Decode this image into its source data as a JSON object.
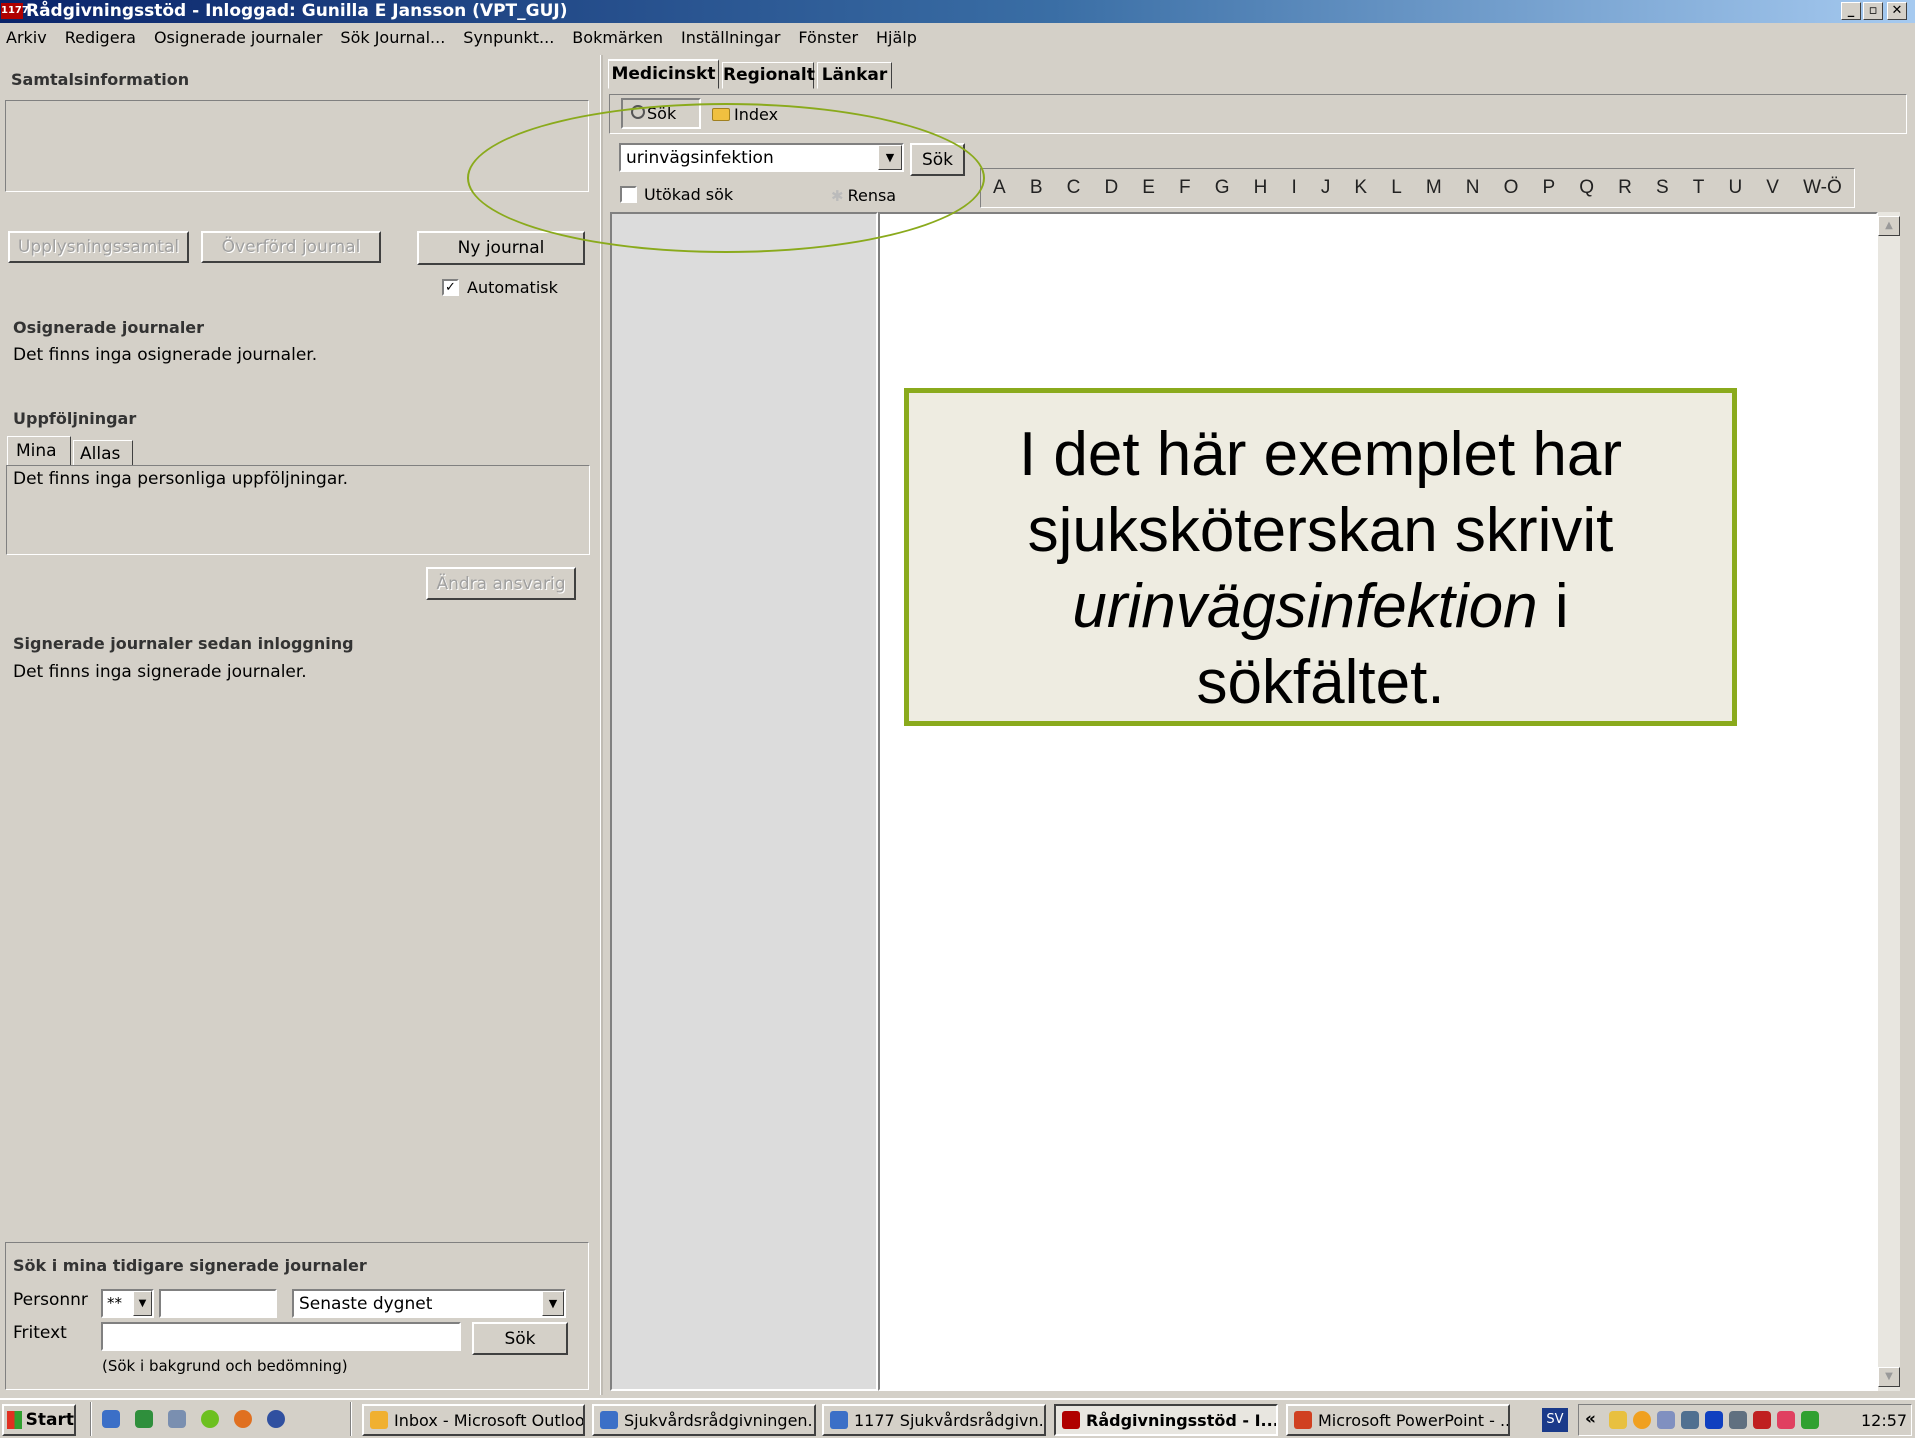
{
  "window": {
    "title": "Rådgivningsstöd - Inloggad: Gunilla E Jansson (VPT_GUJ)",
    "app_badge": "1177",
    "controls": [
      "_",
      "▫",
      "✕"
    ]
  },
  "menu": [
    "Arkiv",
    "Redigera",
    "Osignerade journaler",
    "Sök Journal...",
    "Synpunkt...",
    "Bokmärken",
    "Inställningar",
    "Fönster",
    "Hjälp"
  ],
  "left": {
    "samtal_heading": "Samtalsinformation",
    "buttons": {
      "upplysning": "Upplysningssamtal",
      "overford": "Överförd journal",
      "ny": "Ny journal"
    },
    "automatisk_label": "Automatisk",
    "automatisk_checked": "✓",
    "osignerade_heading": "Osignerade journaler",
    "osignerade_text": "Det finns inga osignerade journaler.",
    "uppfoljningar_heading": "Uppföljningar",
    "tabs": [
      "Mina",
      "Allas"
    ],
    "uppfoljningar_text": "Det finns inga personliga uppföljningar.",
    "andra_button": "Ändra ansvarig",
    "signerade_heading": "Signerade journaler sedan inloggning",
    "signerade_text": "Det finns inga signerade journaler.",
    "search": {
      "heading": "Sök i mina tidigare signerade journaler",
      "personnr_label": "Personnr",
      "personnr_prefix": "**",
      "personnr_value": "",
      "period_value": "Senaste dygnet",
      "fritext_label": "Fritext",
      "fritext_value": "",
      "sok_button": "Sök",
      "hint": "(Sök i bakgrund och bedömning)"
    }
  },
  "right": {
    "tabs": [
      "Medicinskt",
      "Regionalt",
      "Länkar"
    ],
    "subtabs": [
      "Sök",
      "Index"
    ],
    "search_value": "urinvägsinfektion",
    "sok_button": "Sök",
    "utokad_label": "Utökad sök",
    "rensa_label": "Rensa",
    "letters": [
      "A",
      "B",
      "C",
      "D",
      "E",
      "F",
      "G",
      "H",
      "I",
      "J",
      "K",
      "L",
      "M",
      "N",
      "O",
      "P",
      "Q",
      "R",
      "S",
      "T",
      "U",
      "V",
      "W-Ö"
    ]
  },
  "callout": {
    "line1": "I det här exemplet har",
    "line2": "sjuksköterskan skrivit",
    "line3_italic": "urinvägsinfektion",
    "line3_rest": " i",
    "line4": "sökfältet."
  },
  "taskbar": {
    "start": "Start",
    "tasks": [
      "Inbox - Microsoft Outlook",
      "Sjukvårdsrådgivningen...",
      "1177 Sjukvårdsrådgivn...",
      "Rådgivningsstöd - I...",
      "Microsoft PowerPoint - ..."
    ],
    "lang": "SV",
    "chevron": "«",
    "clock": "12:57"
  },
  "colors": {
    "accent_green": "#8aaa1c",
    "callout_bg": "#eeece1",
    "title_blue": "#0a246a"
  }
}
